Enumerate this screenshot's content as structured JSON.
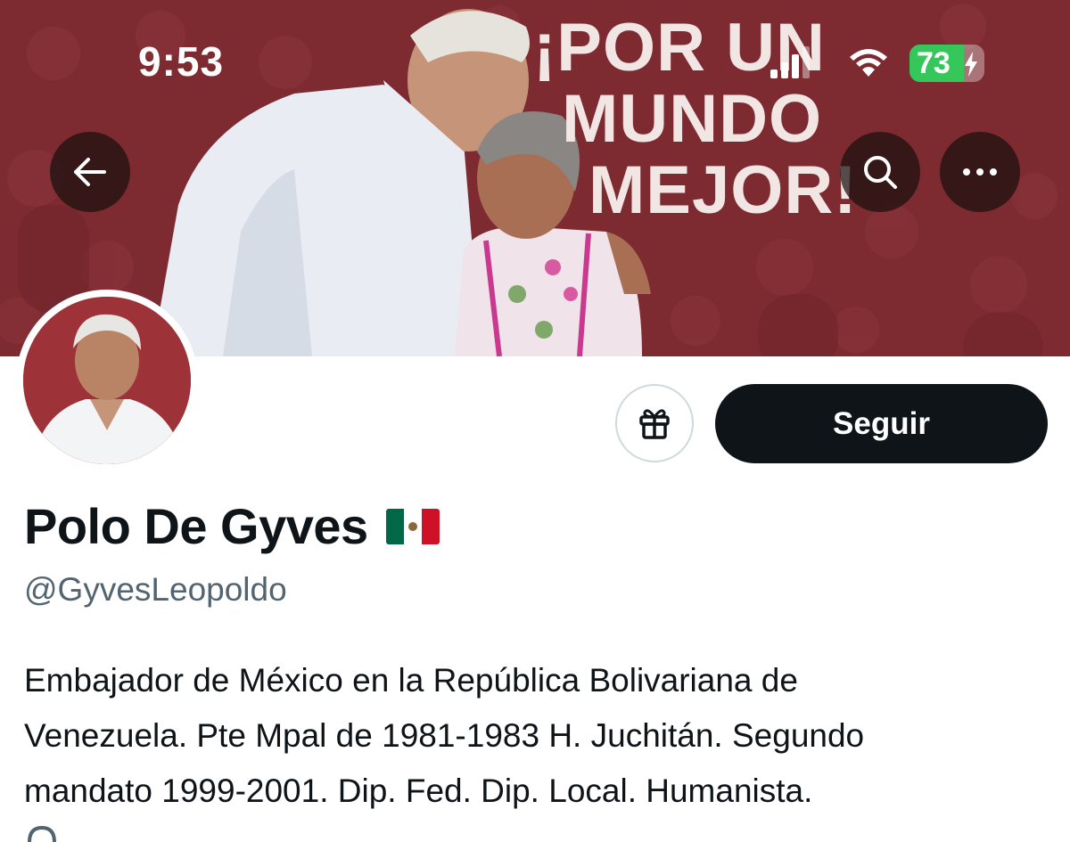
{
  "status_bar": {
    "time": "9:53",
    "battery_percent": "73",
    "battery_level": 0.73,
    "icons": [
      "cellular-signal-icon",
      "wifi-icon",
      "charging-bolt-icon"
    ]
  },
  "banner": {
    "headline_lines": [
      "¡POR UN",
      "MUNDO",
      "MEJOR!"
    ]
  },
  "nav": {
    "back_icon": "arrow-left-icon",
    "search_icon": "search-icon",
    "more_icon": "more-horizontal-icon"
  },
  "actions": {
    "gift_icon": "gift-icon",
    "follow_label": "Seguir"
  },
  "profile": {
    "display_name": "Polo De Gyves",
    "flag_colors": [
      "#006847",
      "#ffffff",
      "#ce1126"
    ],
    "handle": "@GyvesLeopoldo",
    "bio_lines": [
      "Embajador de México en la República Bolivariana de",
      "Venezuela. Pte Mpal de 1981-1983 H. Juchitán. Segundo",
      "mandato 1999-2001. Dip. Fed. Dip. Local. Humanista."
    ],
    "link_icon": "link-icon"
  },
  "colors": {
    "banner": "#7d2b31",
    "follow_button": "#0f1419",
    "secondary_text": "#536471",
    "link": "#1d9bf0",
    "battery": "#35c759"
  }
}
